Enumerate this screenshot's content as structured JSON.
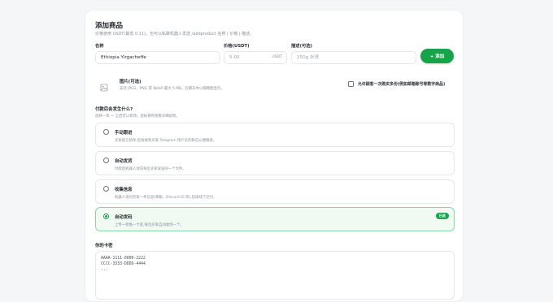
{
  "form": {
    "title": "添加商品",
    "subtitle": "价格使用 USDT(最低 0.11)。也可以私聊机器人发送 /addproduct 名称 | 价格 | 描述。",
    "name_label": "名称",
    "name_value": "Ethiopia Yirgacheffe",
    "price_label": "价格(USDT)",
    "price_value": "5.00",
    "price_suffix": "USDT",
    "desc_label": "描述(可选)",
    "desc_value": "250g 水洗",
    "add_button": "+ 添加"
  },
  "image": {
    "title": "图片(可选)",
    "desc": "支持 JPEG、PNG 或 WebP,最大 5 MB。在聊天中以缩略图显示。",
    "checkbox_label": "允许顾客一次购买多份(例如邮箱账号等数字商品)"
  },
  "delivery": {
    "question": "付款后会发生什么?",
    "hint": "选择一项 — 之后可以修改。鼠标悬停查看详细说明。",
    "options": [
      {
        "title": "手动跟进",
        "desc": "买家留言给你,您会收到买家 Telegram 用户名的私信以便跟进。",
        "selected": false
      },
      {
        "title": "自动发货",
        "desc": "付款后机器人会向每位买家发送同一个文件。",
        "selected": false
      },
      {
        "title": "收集信息",
        "desc": "机器人询问买家一条信息(邮箱、Discord ID 等),您再线下交付。",
        "selected": false
      },
      {
        "title": "自动发码",
        "desc": "上传一批唯一卡密,每位买家自动收到一个。",
        "selected": true,
        "badge": "已选"
      }
    ]
  },
  "codes": {
    "label": "你的卡密",
    "lines": [
      "AAAA-1111-0000-2222",
      "CCCC-3333-DDDD-4444",
      "..."
    ]
  },
  "colors": {
    "accent": "#16a34a",
    "selected_bg": "#f0faf3",
    "selected_border": "#86d6a0"
  },
  "icons": {
    "image": "image-icon",
    "plus": "plus-icon"
  }
}
